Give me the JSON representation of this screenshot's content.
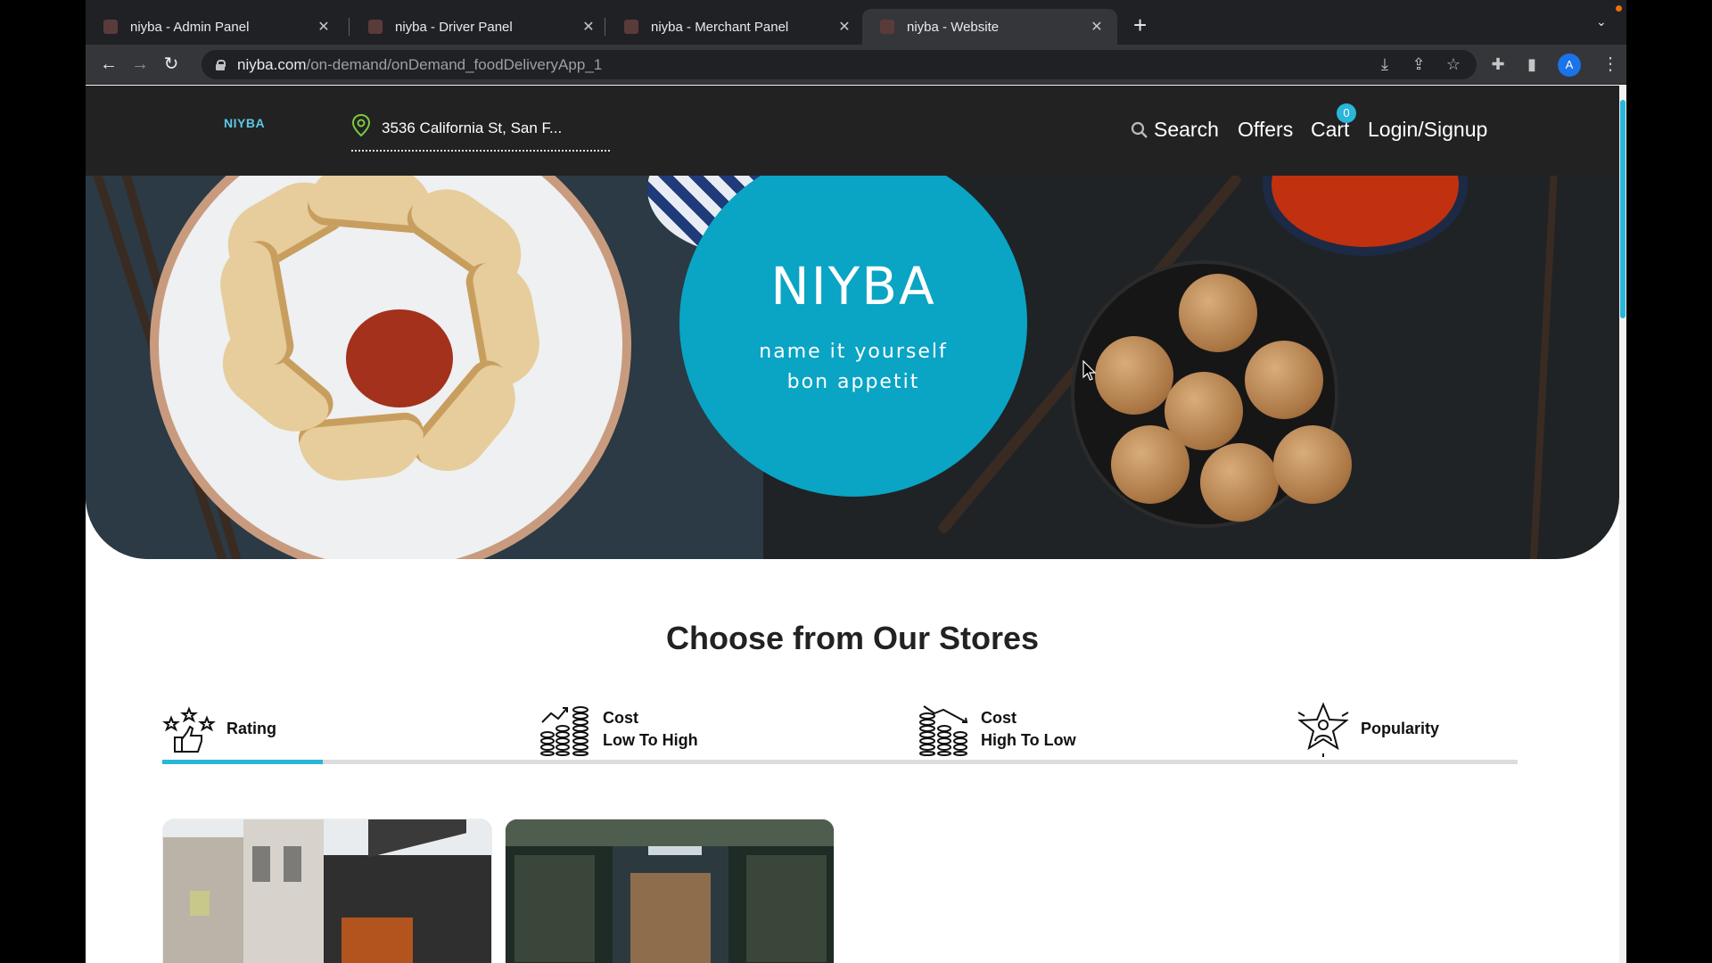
{
  "browser": {
    "tabs": [
      {
        "title": "niyba - Admin Panel"
      },
      {
        "title": "niyba - Driver Panel"
      },
      {
        "title": "niyba - Merchant Panel"
      },
      {
        "title": "niyba - Website"
      }
    ],
    "new_tab_symbol": "+",
    "url_host": "niyba.com",
    "url_path": "/on-demand/onDemand_foodDeliveryApp_1",
    "profile_initial": "A"
  },
  "header": {
    "logo": "NIYBA",
    "location": "3536 California St, San F...",
    "search_label": "Search",
    "offers_label": "Offers",
    "cart_label": "Cart",
    "cart_count": "0",
    "login_label": "Login/Signup"
  },
  "hero": {
    "brand": "NIYBA",
    "tagline_1": "name it yourself",
    "tagline_2": "bon appetit"
  },
  "stores": {
    "title": "Choose from Our Stores",
    "sort_tabs": [
      {
        "line1": "Rating",
        "line2": "",
        "icon": "rating-stars-thumb-icon"
      },
      {
        "line1": "Cost",
        "line2": "Low To High",
        "icon": "coins-up-trend-icon"
      },
      {
        "line1": "Cost",
        "line2": "High To Low",
        "icon": "coins-down-trend-icon"
      },
      {
        "line1": "Popularity",
        "line2": "",
        "icon": "popularity-star-icon"
      }
    ],
    "active_sort": "Rating"
  },
  "colors": {
    "accent": "#29b6d9",
    "hero_circle": "#0aa4c4",
    "header_bg": "#222222"
  }
}
